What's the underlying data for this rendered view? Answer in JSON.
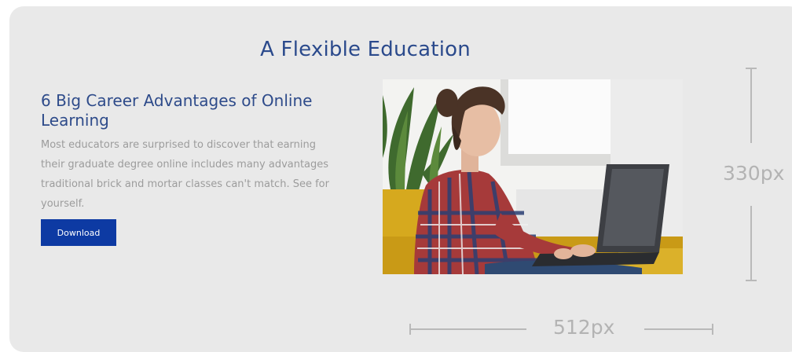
{
  "section": {
    "headline": "A Flexible Education"
  },
  "article": {
    "title": "6 Big Career Advantages of Online Learning",
    "body": "Most educators are surprised to discover that earning their graduate degree online includes many advantages traditional brick and mortar classes can't match. See for yourself.",
    "button_label": "Download"
  },
  "image": {
    "subject": "woman working on laptop on yellow sofa"
  },
  "annotations": {
    "height_label": "330px",
    "width_label": "512px"
  },
  "colors": {
    "card_background": "#e9e9e9",
    "heading_blue": "#2e4b8a",
    "button_blue": "#0d3aa3",
    "body_gray": "#9c9c9c",
    "annotation_gray": "#b3b3b3"
  }
}
